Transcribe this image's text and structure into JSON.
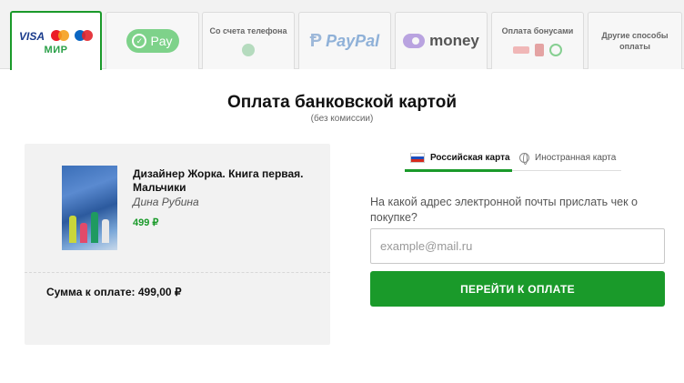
{
  "payment_tabs": {
    "cards": {
      "visa": "VISA",
      "mir": "МИР"
    },
    "sbp": {
      "label": "Pay"
    },
    "phone": {
      "label": "Со счета телефона"
    },
    "paypal": {
      "label": "PayPal"
    },
    "yoomoney": {
      "label": "money"
    },
    "bonus": {
      "label": "Оплата бонусами"
    },
    "other": {
      "label": "Другие способы оплаты"
    }
  },
  "heading": {
    "title": "Оплата банковской картой",
    "subtitle": "(без комиссии)"
  },
  "order": {
    "book_title": "Дизайнер Жорка. Книга первая. Мальчики",
    "author": "Дина Рубина",
    "price": "499 ₽",
    "total": "Сумма к оплате: 499,00 ₽"
  },
  "card_type_tabs": {
    "russian": "Российская карта",
    "foreign": "Иностранная карта"
  },
  "email": {
    "label": "На какой адрес электронной почты прислать чек о покупке?",
    "placeholder": "example@mail.ru",
    "value": ""
  },
  "pay_button": {
    "label": "ПЕРЕЙТИ К ОПЛАТЕ"
  },
  "colors": {
    "accent": "#1a9a2a",
    "card_background": "#f2f2f2"
  }
}
